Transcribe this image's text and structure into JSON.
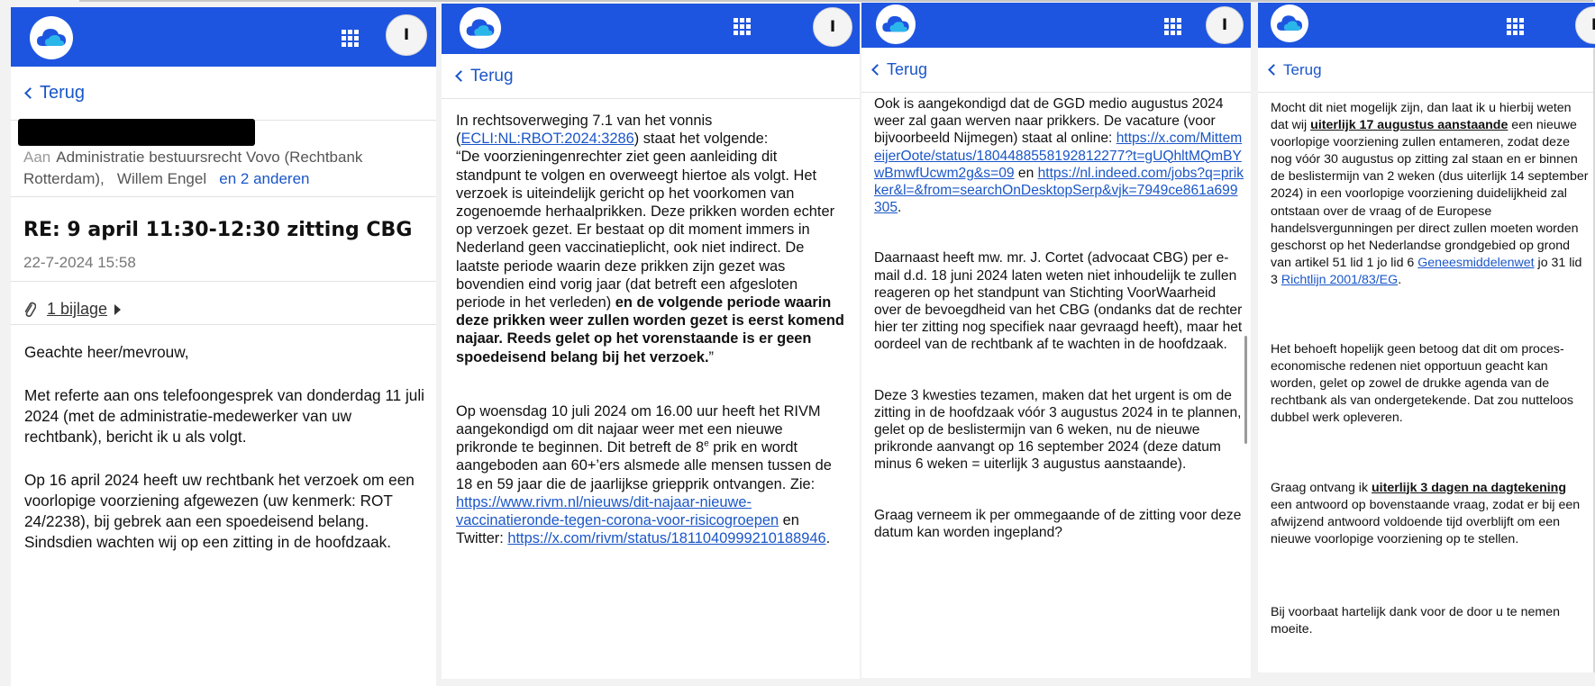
{
  "colors": {
    "appbar": "#1e55e0",
    "link": "#1a56c8"
  },
  "icons": {
    "logo": "cloud-logo-icon",
    "apps": "app-grid-icon",
    "back": "chevron-left-icon",
    "attachment": "paperclip-icon"
  },
  "common": {
    "avatar_initial": "I",
    "back_label": "Terug"
  },
  "panel1": {
    "to_label": "Aan",
    "recipients": "Administratie bestuursrecht Vovo (Rechtbank Rotterdam),",
    "recipient2": "Willem Engel",
    "others": "en 2 anderen",
    "subject": "RE: 9 april 11:30-12:30 zitting CBG",
    "date": "22-7-2024 15:58",
    "attachment": "1 bijlage",
    "greeting": "Geachte heer/mevrouw,",
    "para1": "Met referte aan ons telefoongesprek van donderdag 11 juli 2024 (met de administratie-medewerker van uw rechtbank), bericht ik u als volgt.",
    "para2": "Op 16 april 2024 heeft uw rechtbank het verzoek om een voorlopige voorziening afgewezen (uw kenmerk: ROT 24/2238), bij gebrek aan een spoedeisend belang. Sindsdien wachten wij op een zitting in de hoofdzaak."
  },
  "panel2": {
    "p1_a": "In rechtsoverweging 7.1 van het vonnis (",
    "p1_link": "ECLI:NL:RBOT:2024:3286",
    "p1_b": ") staat het volgende:",
    "p1_quote": "“De voorzieningenrechter ziet geen aanleiding dit standpunt te volgen en overweegt hiertoe als volgt. Het verzoek is uiteindelijk gericht op het voorkomen van zogenoemde herhaalprikken. Deze prikken worden echter op verzoek gezet. Er bestaat op dit moment immers in Nederland geen vaccinatieplicht, ook niet indirect. De laatste periode waarin deze prikken zijn gezet was bovendien eind vorig jaar (dat betreft een afgesloten periode in het verleden)",
    "p1_bold": " en de volgende periode waarin deze prikken weer zullen worden gezet is eerst komend najaar. Reeds gelet op het vorenstaande is er geen spoedeisend belang bij het verzoek.",
    "p1_end": "”",
    "p2_a": "Op woensdag 10 juli 2024 om 16.00 uur heeft het RIVM aangekondigd om dit najaar weer met een nieuwe prikronde te beginnen. Dit betreft de 8",
    "p2_sup": "e",
    "p2_b": " prik en wordt aangeboden aan 60+’ers alsmede alle mensen tussen de 18 en 59 jaar die de jaarlijkse griepprik ontvangen. Zie: ",
    "p2_link1": "https://www.rivm.nl/nieuws/dit-najaar-nieuwe-vaccinatieronde-tegen-corona-voor-risicogroepen",
    "p2_c": " en Twitter: ",
    "p2_link2": "https://x.com/rivm/status/1811040999210188946",
    "p2_d": "."
  },
  "panel3": {
    "p1_a": "Ook is aangekondigd dat de GGD medio augustus 2024 weer zal gaan werven naar prikkers. De vacature (voor bijvoorbeeld Nijmegen) staat al online: ",
    "p1_link1": "https://x.com/MittemeijerOote/status/1804488558192812277?t=gUQhltMQmBYwBmwfUcwm2g&s=09",
    "p1_b": " en ",
    "p1_link2": "https://nl.indeed.com/jobs?q=prikker&l=&from=searchOnDesktopSerp&vjk=7949ce861a699305",
    "p1_c": ".",
    "p2": "Daarnaast heeft mw. mr. J. Cortet (advocaat CBG) per e-mail d.d. 18 juni 2024 laten weten niet inhoudelijk te zullen reageren op het standpunt van Stichting VoorWaarheid over de bevoegdheid van het CBG (ondanks dat de rechter hier ter zitting nog specifiek naar gevraagd heeft), maar het oordeel van de rechtbank af te wachten in de hoofdzaak.",
    "p3": "Deze 3 kwesties tezamen, maken dat het urgent is om de zitting in de hoofdzaak vóór 3 augustus 2024 in te plannen, gelet op de beslistermijn van 6 weken, nu de nieuwe prikronde aanvangt op 16 september 2024 (deze datum minus 6 weken = uiterlijk 3 augustus aanstaande).",
    "p4": "Graag verneem ik per ommegaande of de zitting voor deze datum kan worden ingepland?"
  },
  "panel4": {
    "p1_a": "Mocht dit niet mogelijk zijn, dan laat ik u hierbij weten dat wij ",
    "p1_bold": "uiterlijk 17 augustus aanstaande",
    "p1_b": " een nieuwe voorlopige voorziening zullen entameren, zodat deze nog vóór 30 augustus op zitting zal staan en er binnen de beslistermijn van 2 weken (dus uiterlijk 14 september 2024) in een voorlopige voorziening duidelijkheid zal ontstaan over de vraag of de Europese handelsvergunningen per direct zullen moeten worden geschorst op het Nederlandse grondgebied op grond van artikel 51 lid 1 jo lid 6 ",
    "p1_link1": "Geneesmiddelenwet",
    "p1_c": " jo 31 lid 3 ",
    "p1_link2": "Richtlijn 2001/83/EG",
    "p1_d": ".",
    "p2": "Het behoeft hopelijk geen betoog dat dit om proces-economische redenen niet opportuun geacht kan worden, gelet op zowel de drukke agenda van de rechtbank als van ondergetekende. Dat zou nutteloos dubbel werk opleveren.",
    "p3_a": "Graag ontvang ik ",
    "p3_bold": "uiterlijk 3 dagen na dagtekening",
    "p3_b": " een antwoord op bovenstaande vraag, zodat er bij een afwijzend antwoord voldoende tijd overblijft om een nieuwe voorlopige voorziening op te stellen.",
    "p4": "Bij voorbaat hartelijk dank voor de door u te nemen moeite."
  }
}
